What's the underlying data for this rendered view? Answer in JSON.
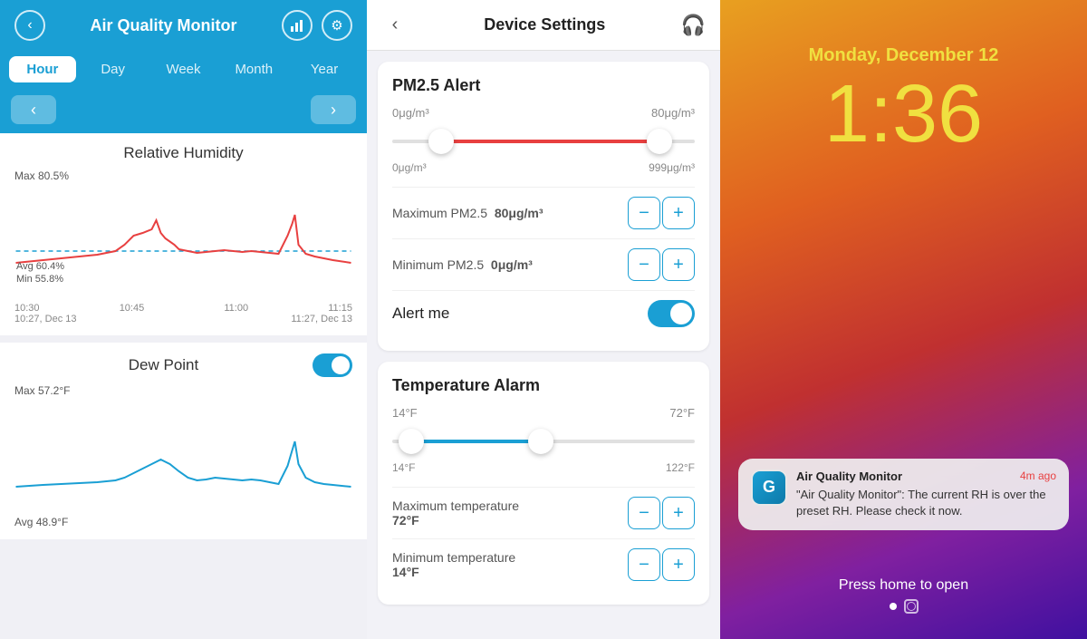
{
  "left_panel": {
    "header": {
      "title": "Air Quality Monitor",
      "back_label": "‹",
      "chart_icon": "📊",
      "settings_icon": "⚙"
    },
    "tabs": [
      "Hour",
      "Day",
      "Week",
      "Month",
      "Year"
    ],
    "active_tab": 0,
    "humidity_chart": {
      "title": "Relative Humidity",
      "max_label": "Max 80.5%",
      "avg_label": "Avg 60.4%",
      "min_label": "Min 55.8%",
      "time_labels": [
        "10:30",
        "10:45",
        "11:00",
        "11:15"
      ],
      "date_labels": [
        "10:27, Dec 13",
        "11:27, Dec 13"
      ]
    },
    "dewpoint_chart": {
      "title": "Dew Point",
      "max_label": "Max 57.2°F",
      "avg_label": "Avg 48.9°F"
    }
  },
  "middle_panel": {
    "header": {
      "title": "Device Settings",
      "back_label": "‹"
    },
    "pm25_alert": {
      "title": "PM2.5 Alert",
      "range_min_top": "0μg/m³",
      "range_max_top": "80μg/m³",
      "range_min_bottom": "0μg/m³",
      "range_max_bottom": "999μg/m³",
      "max_label": "Maximum PM2.5",
      "max_value": "80μg/m³",
      "min_label": "Minimum PM2.5",
      "min_value": "0μg/m³",
      "alert_me_label": "Alert me",
      "alert_me_on": true
    },
    "temp_alarm": {
      "title": "Temperature Alarm",
      "range_min_top": "14°F",
      "range_max_top": "72°F",
      "range_min_bottom": "14°F",
      "range_max_bottom": "122°F",
      "max_label": "Maximum temperature\n72°F",
      "min_label": "Minimum temperature\n14°F"
    }
  },
  "right_panel": {
    "date": "Monday, December 12",
    "time": "1:36",
    "notification": {
      "app_name": "Air Quality Monitor",
      "time_ago": "4m ago",
      "message": "\"Air Quality Monitor\": The current RH is over the preset RH. Please check it now.",
      "app_initial": "G"
    },
    "press_home": "Press home to open"
  }
}
